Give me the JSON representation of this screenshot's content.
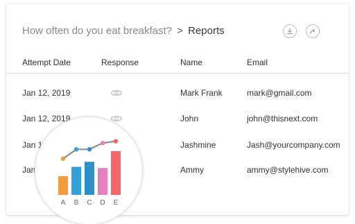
{
  "header": {
    "question": "How often do you eat breakfast?",
    "separator": ">",
    "current": "Reports",
    "download_icon": "download-icon",
    "share_icon": "share-icon"
  },
  "table": {
    "columns": [
      "Attempt Date",
      "Response",
      "Name",
      "Email"
    ],
    "rows": [
      {
        "date": "Jan 12, 2019",
        "response_icon": "eye-icon",
        "name": "Mark Frank",
        "email": "mark@gmail.com"
      },
      {
        "date": "Jan 12, 2019",
        "response_icon": "eye-icon",
        "name": "John",
        "email": "john@thisnext.com"
      },
      {
        "date": "Jan 11",
        "name": "Jashmine",
        "email": "Jash@yourcompany.com"
      },
      {
        "date": "Jan 1",
        "name": "Ammy",
        "email": "ammy@stylehive.com"
      }
    ]
  },
  "chart_data": {
    "type": "bar",
    "categories": [
      "A",
      "B",
      "C",
      "D",
      "E"
    ],
    "values": [
      30,
      45,
      53,
      43,
      70
    ],
    "line": [
      58,
      73,
      73,
      83,
      86
    ],
    "bar_colors": [
      "#f39a3d",
      "#35a0d8",
      "#2f8fc9",
      "#ea7fbf",
      "#f26868"
    ],
    "point_colors": [
      "#f39a3d",
      "#35a0d8",
      "#2f8fc9",
      "#ea7fbf",
      "#f26868"
    ],
    "line_color": "#8c8c8c",
    "ylim": [
      0,
      100
    ]
  }
}
